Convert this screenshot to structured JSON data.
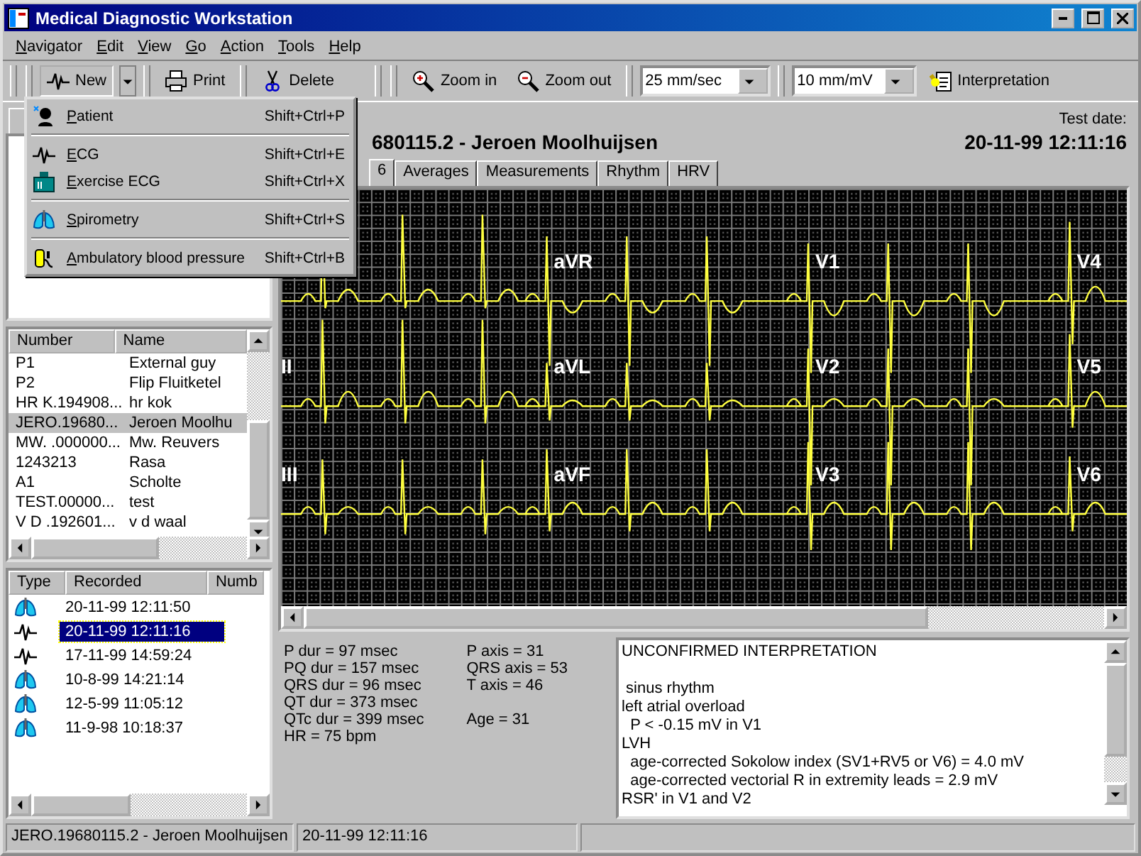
{
  "window": {
    "title": "Medical Diagnostic Workstation"
  },
  "menu": [
    "Navigator",
    "Edit",
    "View",
    "Go",
    "Action",
    "Tools",
    "Help"
  ],
  "toolbar": {
    "new": "New",
    "print": "Print",
    "delete": "Delete",
    "zoom_in": "Zoom in",
    "zoom_out": "Zoom out",
    "speed": "25 mm/sec",
    "gain": "10 mm/mV",
    "interpretation": "Interpretation"
  },
  "new_menu": [
    [
      {
        "label": "Patient",
        "shortcut": "Shift+Ctrl+P"
      }
    ],
    [
      {
        "label": "ECG",
        "shortcut": "Shift+Ctrl+E"
      },
      {
        "label": "Exercise ECG",
        "shortcut": "Shift+Ctrl+X"
      }
    ],
    [
      {
        "label": "Spirometry",
        "shortcut": "Shift+Ctrl+S"
      }
    ],
    [
      {
        "label": "Ambulatory blood pressure",
        "shortcut": "Shift+Ctrl+B"
      }
    ]
  ],
  "patients": {
    "columns": [
      "Number",
      "Name"
    ],
    "rows": [
      {
        "number": "P1",
        "name": "External guy",
        "selected": false
      },
      {
        "number": "P2",
        "name": "Flip Fluitketel",
        "selected": false
      },
      {
        "number": "HR K.194908...",
        "name": "hr kok",
        "selected": false
      },
      {
        "number": "JERO.19680...",
        "name": "Jeroen Moolhu",
        "selected": true
      },
      {
        "number": "MW. .000000...",
        "name": "Mw. Reuvers",
        "selected": false
      },
      {
        "number": "1243213",
        "name": "Rasa",
        "selected": false
      },
      {
        "number": "A1",
        "name": "Scholte",
        "selected": false
      },
      {
        "number": "TEST.00000...",
        "name": "test",
        "selected": false
      },
      {
        "number": "V D .192601...",
        "name": "v d waal",
        "selected": false
      }
    ]
  },
  "records": {
    "columns": [
      "Type",
      "Recorded",
      "Numb"
    ],
    "rows": [
      {
        "kind": "spirometry",
        "recorded": "20-11-99 12:11:50",
        "selected": false
      },
      {
        "kind": "ecg",
        "recorded": "20-11-99 12:11:16",
        "selected": true
      },
      {
        "kind": "ecg",
        "recorded": "17-11-99 14:59:24",
        "selected": false
      },
      {
        "kind": "spirometry",
        "recorded": "10-8-99 14:21:14",
        "selected": false
      },
      {
        "kind": "spirometry",
        "recorded": "12-5-99 11:05:12",
        "selected": false
      },
      {
        "kind": "spirometry",
        "recorded": "11-9-98 10:18:37",
        "selected": false
      }
    ]
  },
  "header": {
    "title": "680115.2 - Jeroen Moolhuijsen",
    "test_date_label": "Test date:",
    "test_date": "20-11-99 12:11:16"
  },
  "tabs": [
    {
      "label": "6",
      "selected": true
    },
    {
      "label": "Averages",
      "selected": false
    },
    {
      "label": "Measurements",
      "selected": false
    },
    {
      "label": "Rhythm",
      "selected": false
    },
    {
      "label": "HRV",
      "selected": false
    }
  ],
  "lead_rows": [
    [
      "aVR",
      "V1",
      "V4"
    ],
    [
      "II",
      "aVL",
      "V2",
      "V5"
    ],
    [
      "III",
      "aVF",
      "V3",
      "V6"
    ]
  ],
  "measurements": {
    "column_1": [
      [
        "P dur = 97 msec",
        "PQ dur = 157 msec",
        "QRS dur = 96 msec",
        "QT dur = 373 msec",
        "QTc dur = 399 msec",
        "HR = 75 bpm"
      ]
    ],
    "column_2": [
      [
        "P axis = 31",
        "QRS axis = 53",
        "T axis = 46"
      ],
      [
        "Age = 31"
      ]
    ]
  },
  "interpretation": {
    "title": "UNCONFIRMED INTERPRETATION",
    "lines": [
      " sinus rhythm",
      "left atrial overload",
      "  P < -0.15 mV in V1",
      "LVH",
      "  age-corrected Sokolow index (SV1+RV5 or V6) = 4.0 mV",
      "  age-corrected vectorial R in extremity leads = 2.9 mV",
      "RSR' in V1 and V2"
    ]
  },
  "status_bar": [
    "JERO.19680115.2 - Jeroen Moolhuijsen",
    "20-11-99 12:11:16"
  ]
}
